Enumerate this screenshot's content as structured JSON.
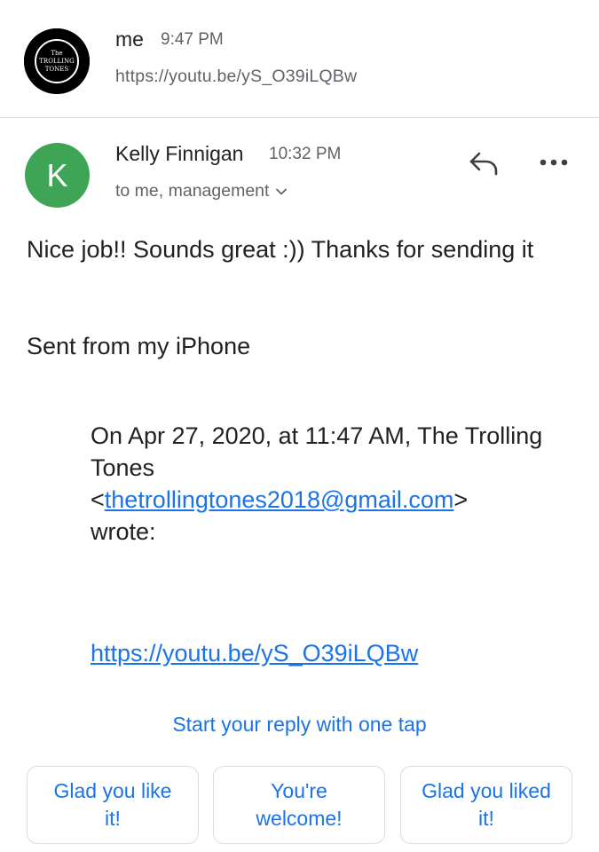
{
  "first_message": {
    "sender": "me",
    "time": "9:47 PM",
    "preview": "https://youtu.be/yS_O39iLQBw",
    "avatar_logo_text": [
      "The",
      "TROLLING",
      "TONES"
    ]
  },
  "second_message": {
    "avatar_letter": "K",
    "sender": "Kelly Finnigan",
    "time": "10:32 PM",
    "recipients": "to me, management",
    "body": "Nice job!! Sounds great :)) Thanks for sending it",
    "signature": "Sent from my iPhone",
    "quote": {
      "intro": "On Apr 27, 2020, at 11:47 AM, The Trolling Tones",
      "lt": "<",
      "email": "thetrollingtones2018@gmail.com",
      "gt": ">",
      "wrote": "wrote:"
    },
    "link": "https://youtu.be/yS_O39iLQBw"
  },
  "icons": {
    "reply": "reply-icon",
    "more": "more-horiz-icon",
    "expand": "chevron-down-icon"
  },
  "smart_reply": {
    "title": "Start your reply with one tap",
    "chips": [
      "Glad you like it!",
      "You're welcome!",
      "Glad you liked it!"
    ]
  },
  "colors": {
    "accent": "#1a73e8",
    "avatar_green": "#3ea556",
    "secondary_text": "#5f6368"
  }
}
